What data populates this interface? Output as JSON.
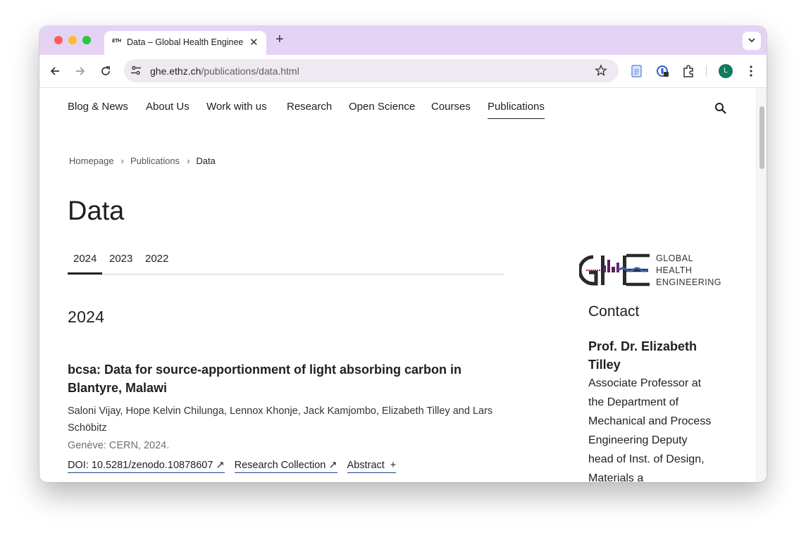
{
  "browser": {
    "tab_title": "Data – Global Health Enginee",
    "tab_favicon": "ETH",
    "url_host": "ghe.ethz.ch",
    "url_path": "/publications/data.html",
    "profile_initial": "L"
  },
  "nav": {
    "items": [
      "Blog & News",
      "About Us",
      "Work with us",
      "Research",
      "Open Science",
      "Courses",
      "Publications"
    ],
    "active": "Publications"
  },
  "breadcrumb": {
    "items": [
      "Homepage",
      "Publications"
    ],
    "current": "Data"
  },
  "page": {
    "title": "Data",
    "year_tabs": [
      "2024",
      "2023",
      "2022"
    ],
    "active_year": "2024",
    "section_heading": "2024"
  },
  "publication": {
    "title": "bcsa: Data for source-apportionment of light absorbing carbon in Blantyre, Malawi",
    "authors": "Saloni Vijay, Hope Kelvin Chilunga, Lennox Khonje, Jack Kamjombo, Elizabeth Tilley and Lars Schöbitz",
    "source": "Genève: CERN, 2024.",
    "links": {
      "doi": "DOI: 10.5281/zenodo.10878607",
      "research_collection": "Research Collection",
      "abstract": "Abstract"
    }
  },
  "logo": {
    "line1": "GLOBAL",
    "line2": "HEALTH",
    "line3": "ENGINEERING"
  },
  "contact": {
    "heading": "Contact",
    "name": "Prof. Dr. Elizabeth Tilley",
    "description": "Associate Professor at the Department of Mechanical and Process Engineering Deputy head of Inst. of Design, Materials a"
  },
  "colors": {
    "tabbar_bg": "#e5d3f5",
    "link_underline": "#1f3f8a",
    "logo_purple": "#5a1f5e",
    "logo_blue": "#3a5fa8",
    "profile_bg": "#0f7a5e"
  }
}
